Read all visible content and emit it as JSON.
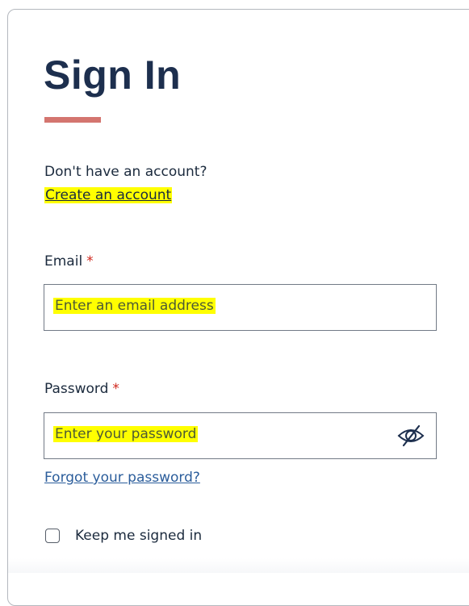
{
  "page": {
    "title": "Sign In",
    "no_account_text": "Don't have an account?",
    "create_account_link": "Create an account"
  },
  "email": {
    "label": "Email",
    "required_marker": "*",
    "placeholder": "Enter an email address"
  },
  "password": {
    "label": "Password",
    "required_marker": "*",
    "placeholder": "Enter your password",
    "visibility_icon": "eye-slash-icon"
  },
  "forgot_password_link": "Forgot your password?",
  "keep_signed_in": {
    "label": "Keep me signed in",
    "checked": false
  },
  "colors": {
    "title": "#1d2f4e",
    "accent_bar": "#d4756f",
    "required": "#d0271d",
    "link": "#2b5d9b",
    "highlight": "#ffff00"
  }
}
